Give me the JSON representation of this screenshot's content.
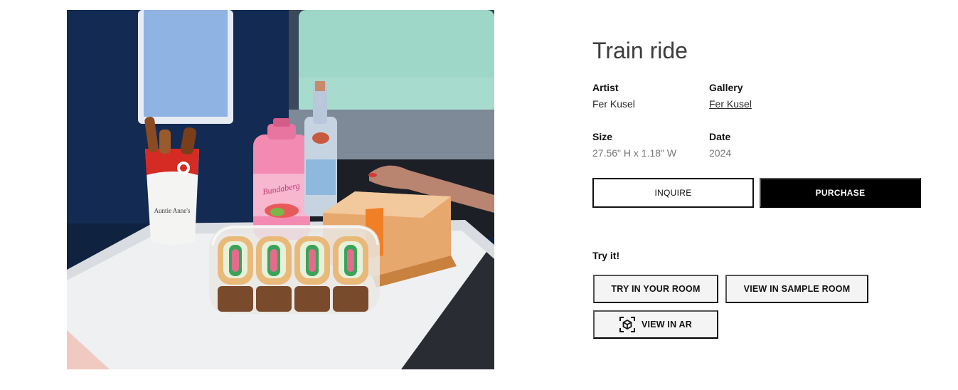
{
  "artwork": {
    "alt": "Painting of a train table with a pretzel cup, a pink soda bottle, a glass bottle and boxed sandwiches",
    "icon": "artwork-image",
    "cup_text": "Auntie Anne's",
    "bottle_text": "Bundaberg"
  },
  "details": {
    "title": "Train ride",
    "artist_label": "Artist",
    "artist_value": "Fer Kusel",
    "gallery_label": "Gallery",
    "gallery_value": "Fer Kusel",
    "size_label": "Size",
    "size_value": "27.56\" H x 1.18\" W",
    "date_label": "Date",
    "date_value": "2024"
  },
  "actions": {
    "inquire_label": "INQUIRE",
    "purchase_label": "PURCHASE"
  },
  "try_it": {
    "section_label": "Try it!",
    "room_label": "TRY IN YOUR ROOM",
    "sample_label": "VIEW IN SAMPLE ROOM",
    "ar_label": "VIEW IN AR",
    "ar_icon": "ar-cube-icon"
  },
  "colors": {
    "primary": "#000000",
    "background": "#ffffff",
    "muted_text": "#777777",
    "grey_button": "#f4f4f4"
  }
}
